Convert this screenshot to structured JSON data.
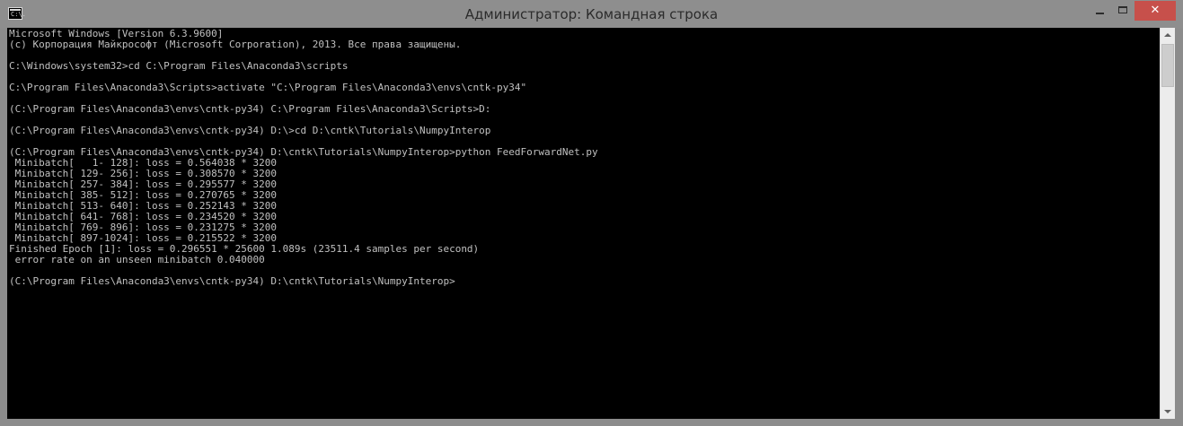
{
  "window": {
    "title": "Администратор: Командная строка",
    "icon": "cmd-icon",
    "icon_text": "C:\\.",
    "close_symbol": "✕",
    "accent_close": "#c7504b"
  },
  "console": {
    "background": "#000000",
    "foreground": "#c0c0c0",
    "lines": [
      "Microsoft Windows [Version 6.3.9600]",
      "(c) Корпорация Майкрософт (Microsoft Corporation), 2013. Все права защищены.",
      "",
      "C:\\Windows\\system32>cd C:\\Program Files\\Anaconda3\\scripts",
      "",
      "C:\\Program Files\\Anaconda3\\Scripts>activate \"C:\\Program Files\\Anaconda3\\envs\\cntk-py34\"",
      "",
      "(C:\\Program Files\\Anaconda3\\envs\\cntk-py34) C:\\Program Files\\Anaconda3\\Scripts>D:",
      "",
      "(C:\\Program Files\\Anaconda3\\envs\\cntk-py34) D:\\>cd D:\\cntk\\Tutorials\\NumpyInterop",
      "",
      "(C:\\Program Files\\Anaconda3\\envs\\cntk-py34) D:\\cntk\\Tutorials\\NumpyInterop>python FeedForwardNet.py",
      " Minibatch[   1- 128]: loss = 0.564038 * 3200",
      " Minibatch[ 129- 256]: loss = 0.308570 * 3200",
      " Minibatch[ 257- 384]: loss = 0.295577 * 3200",
      " Minibatch[ 385- 512]: loss = 0.270765 * 3200",
      " Minibatch[ 513- 640]: loss = 0.252143 * 3200",
      " Minibatch[ 641- 768]: loss = 0.234520 * 3200",
      " Minibatch[ 769- 896]: loss = 0.231275 * 3200",
      " Minibatch[ 897-1024]: loss = 0.215522 * 3200",
      "Finished Epoch [1]: loss = 0.296551 * 25600 1.089s (23511.4 samples per second)",
      " error rate on an unseen minibatch 0.040000",
      "",
      "(C:\\Program Files\\Anaconda3\\envs\\cntk-py34) D:\\cntk\\Tutorials\\NumpyInterop>"
    ]
  }
}
